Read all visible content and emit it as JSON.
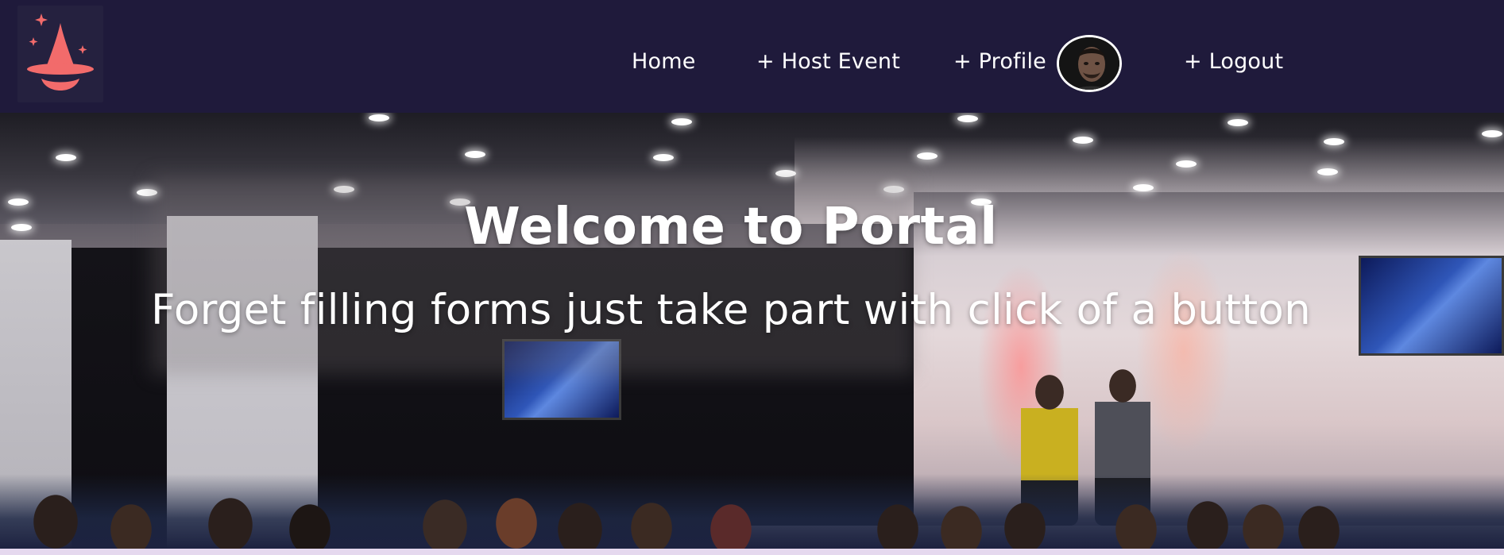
{
  "navbar": {
    "background": "#1f1a3b",
    "logo": {
      "icon": "wizard-hat-icon",
      "color": "#f26b6b"
    },
    "links": [
      {
        "label": "Home"
      },
      {
        "label": "+ Host Event"
      },
      {
        "label": "+ Profile"
      },
      {
        "label": "+ Logout"
      }
    ],
    "avatar": {
      "icon": "user-avatar"
    }
  },
  "hero": {
    "title": "Welcome to Portal",
    "subtitle": "Forget filling forms just take part with click of a button"
  }
}
